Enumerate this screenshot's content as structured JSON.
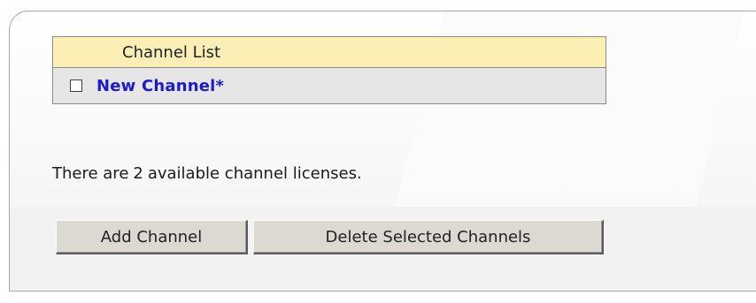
{
  "channel_list": {
    "header": "Channel List",
    "items": [
      {
        "label": "New Channel*",
        "checked": false
      }
    ]
  },
  "licenses": {
    "prefix": "There are",
    "count": "2",
    "suffix": "available channel licenses."
  },
  "buttons": {
    "add": "Add Channel",
    "delete": "Delete Selected Channels"
  },
  "colors": {
    "header_bg": "#fcefb5",
    "row_bg": "#e6e6e6",
    "link": "#1a1adf",
    "button_bg": "#dcd8d2"
  }
}
